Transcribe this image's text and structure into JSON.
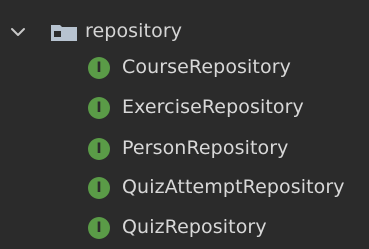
{
  "project_tree": {
    "folder": {
      "name": "repository",
      "expanded": true,
      "icon": "package-folder-icon"
    },
    "children": [
      {
        "name": "CourseRepository",
        "type_badge": "I",
        "icon": "interface-icon"
      },
      {
        "name": "ExerciseRepository",
        "type_badge": "I",
        "icon": "interface-icon"
      },
      {
        "name": "PersonRepository",
        "type_badge": "I",
        "icon": "interface-icon"
      },
      {
        "name": "QuizAttemptRepository",
        "type_badge": "I",
        "icon": "interface-icon"
      },
      {
        "name": "QuizRepository",
        "type_badge": "I",
        "icon": "interface-icon"
      }
    ]
  },
  "colors": {
    "background": "#2b2b2b",
    "text": "#d8d8d8",
    "interface_badge": "#5a9b47",
    "folder_icon": "#b7c3d0"
  }
}
